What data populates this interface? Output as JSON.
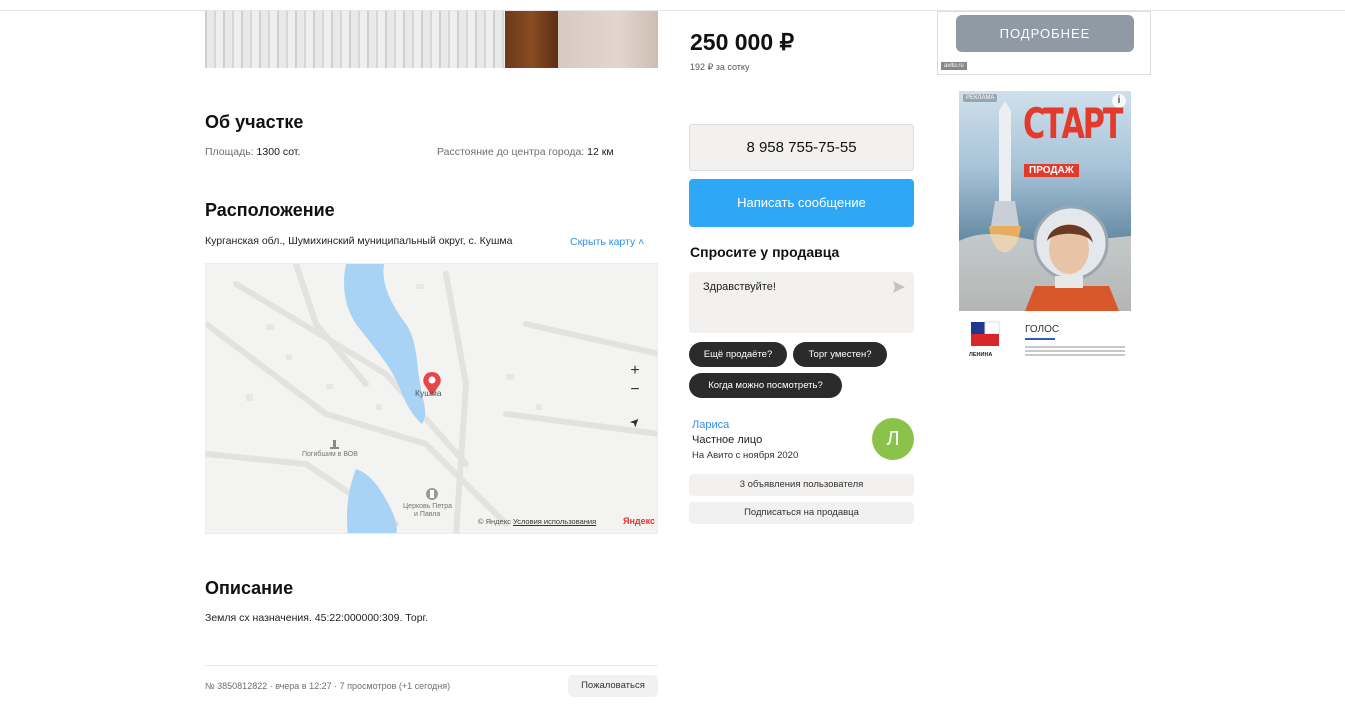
{
  "listing": {
    "about": {
      "title": "Об участке",
      "area_label": "Площадь:",
      "area_value": "1300 сот.",
      "distance_label": "Расстояние до центра города:",
      "distance_value": "12 км"
    },
    "location": {
      "title": "Расположение",
      "address": "Курганская обл., Шумихинский муниципальный округ, с. Кушма",
      "toggle_map": "Скрыть карту ˄"
    },
    "map": {
      "place_label": "Кушма",
      "memorial_label": "Погибшим в ВОВ",
      "church_label_1": "Церковь Петра",
      "church_label_2": "и Павла",
      "zoom_in": "+",
      "zoom_out": "−",
      "locate": "➤",
      "attrib_copy": "© Яндекс",
      "attrib_terms": "Условия использования",
      "brand": "Яндекс",
      "water_color": "#a9d3f5"
    },
    "description": {
      "title": "Описание",
      "text": "Земля сх назначения. 45:22:000000:309. Торг."
    },
    "footer": {
      "meta": "№ 3850812822 · вчера в 12:27 · 7 просмотров (+1 сегодня)",
      "complain": "Пожаловаться"
    }
  },
  "sidebar": {
    "price": "250 000 ₽",
    "price_per": "192 ₽ за сотку",
    "phone": "8 958 755-75-55",
    "write_message": "Написать сообщение",
    "ask_title": "Спросите у продавца",
    "ask_placeholder": "Здравствуйте!",
    "quick_questions": [
      "Ещё продаёте?",
      "Торг уместен?",
      "Когда можно посмотреть?"
    ],
    "seller": {
      "name": "Лариса",
      "type": "Частное лицо",
      "since": "На Авито с ноября 2020",
      "avatar_letter": "Л",
      "avatar_color": "#8bc34a"
    },
    "user_ads": "3 объявления пользователя",
    "subscribe": "Подписаться на продавца",
    "accent_color": "#2ea8f6"
  },
  "ads": {
    "top_button": "ПОДРОБНЕЕ",
    "top_tag": "avito.ru",
    "banner_tag": "РЕКЛАМА",
    "banner_info": "i",
    "banner_headline": "СТАРТ",
    "banner_sub": "ПРОДАЖ",
    "logo_brand": "ЛЕНИНА",
    "logo_partner": "ГОЛОС"
  }
}
